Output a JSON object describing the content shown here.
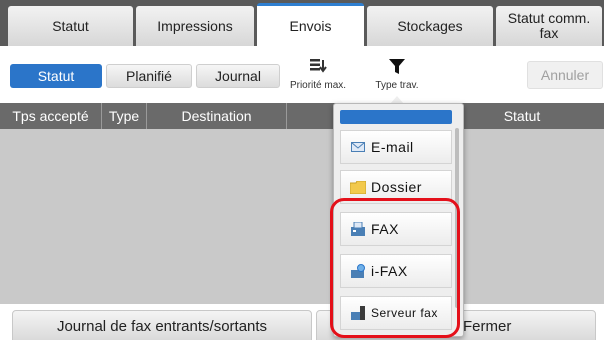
{
  "tabs": [
    {
      "label": "Statut"
    },
    {
      "label": "Impressions"
    },
    {
      "label": "Envois"
    },
    {
      "label": "Stockages"
    },
    {
      "label": "Statut comm. fax"
    }
  ],
  "toolbar": {
    "statut_label": "Statut",
    "planifie_label": "Planifié",
    "journal_label": "Journal",
    "priorite_label": "Priorité max.",
    "type_label": "Type trav.",
    "annuler_label": "Annuler"
  },
  "table": {
    "headers": [
      "Tps accepté",
      "Type",
      "Destination",
      "Statut"
    ]
  },
  "dropdown": {
    "items": [
      {
        "label": "E-mail",
        "icon": "email-icon"
      },
      {
        "label": "Dossier",
        "icon": "folder-icon"
      },
      {
        "label": "FAX",
        "icon": "fax-icon"
      },
      {
        "label": "i-FAX",
        "icon": "ifax-icon"
      },
      {
        "label": "Serveur fax",
        "icon": "fax-server-icon"
      }
    ]
  },
  "bottom": {
    "journal_fax_label": "Journal de fax entrants/sortants",
    "fermer_label": "Fermer"
  },
  "colors": {
    "accent_blue": "#2b75c9",
    "highlight_red": "#e4101a",
    "tabbar_bg": "#5a5a5a",
    "header_bg": "#6a6a6a",
    "body_bg": "#c9c9c9"
  }
}
